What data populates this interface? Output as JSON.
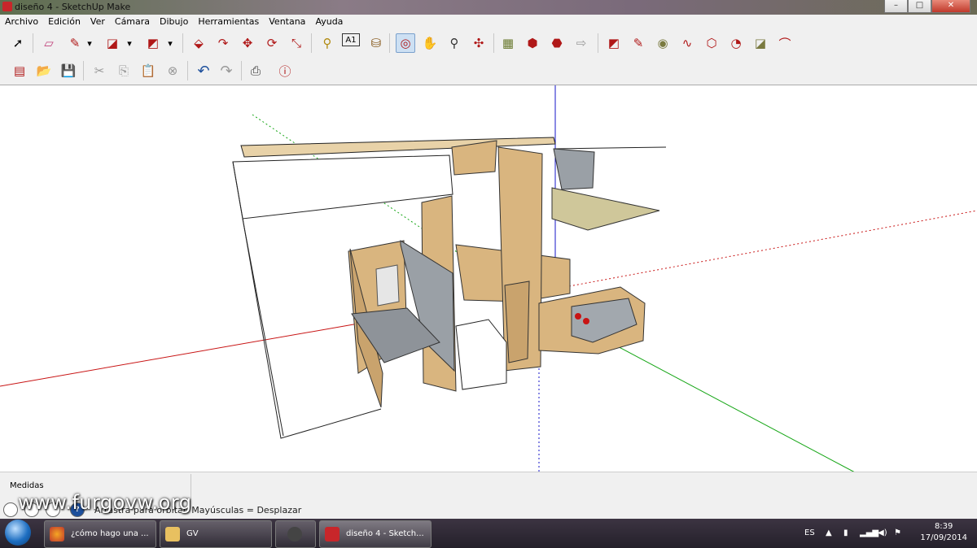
{
  "window": {
    "title": "diseño 4 - SketchUp Make",
    "min": "–",
    "max": "□",
    "close": "✕"
  },
  "menu": [
    "Archivo",
    "Edición",
    "Ver",
    "Cámara",
    "Dibujo",
    "Herramientas",
    "Ventana",
    "Ayuda"
  ],
  "toolbar1": [
    {
      "name": "select-tool-icon",
      "glyph": "➚"
    },
    {
      "name": "eraser-tool-icon",
      "glyph": "▱"
    },
    {
      "name": "pencil-tool-icon",
      "glyph": "✎"
    },
    {
      "name": "dropdown-arrow-icon",
      "glyph": "▾"
    },
    {
      "name": "arc-tool-icon",
      "glyph": "◪"
    },
    {
      "name": "dropdown-arrow-icon",
      "glyph": "▾"
    },
    {
      "name": "rectangle-tool-icon",
      "glyph": "◩"
    },
    {
      "name": "dropdown-arrow-icon",
      "glyph": "▾"
    },
    {
      "name": "push-pull-tool-icon",
      "glyph": "⬙"
    },
    {
      "name": "follow-me-tool-icon",
      "glyph": "↷"
    },
    {
      "name": "move-tool-icon",
      "glyph": "✥"
    },
    {
      "name": "rotate-tool-icon",
      "glyph": "⟳"
    },
    {
      "name": "scale-tool-icon",
      "glyph": "⤡"
    },
    {
      "name": "tape-measure-icon",
      "glyph": "⚲"
    },
    {
      "name": "text-tool-icon",
      "glyph": "A1"
    },
    {
      "name": "paint-bucket-icon",
      "glyph": "⛁"
    },
    {
      "name": "orbit-tool-icon",
      "glyph": "◎"
    },
    {
      "name": "pan-tool-icon",
      "glyph": "✋"
    },
    {
      "name": "zoom-tool-icon",
      "glyph": "⚲"
    },
    {
      "name": "zoom-extents-icon",
      "glyph": "✣"
    },
    {
      "name": "warehouse-icon",
      "glyph": "▦"
    },
    {
      "name": "share-model-icon",
      "glyph": "⬢"
    },
    {
      "name": "extension-warehouse-icon",
      "glyph": "⬣"
    },
    {
      "name": "send-to-layout-icon",
      "glyph": "⇨"
    },
    {
      "name": "sandbox-tool-icon",
      "glyph": "◩"
    },
    {
      "name": "freehand-tool-icon",
      "glyph": "✎"
    },
    {
      "name": "circle-tool-icon",
      "glyph": "◉"
    },
    {
      "name": "curve-tool-icon",
      "glyph": "∿"
    },
    {
      "name": "polygon-tool-icon",
      "glyph": "⬡"
    },
    {
      "name": "pie-tool-icon",
      "glyph": "◔"
    },
    {
      "name": "arc-3pt-tool-icon",
      "glyph": "◪"
    },
    {
      "name": "arc-2pt-tool-icon",
      "glyph": "⌒"
    }
  ],
  "toolbar2": [
    {
      "name": "new-file-icon",
      "glyph": "▤"
    },
    {
      "name": "open-file-icon",
      "glyph": "📂"
    },
    {
      "name": "save-file-icon",
      "glyph": "💾"
    },
    {
      "name": "cut-icon",
      "glyph": "✂"
    },
    {
      "name": "copy-icon",
      "glyph": "⎘"
    },
    {
      "name": "paste-icon",
      "glyph": "📋"
    },
    {
      "name": "delete-icon",
      "glyph": "⊗"
    },
    {
      "name": "undo-icon",
      "glyph": "↶"
    },
    {
      "name": "redo-icon",
      "glyph": "↷"
    },
    {
      "name": "print-icon",
      "glyph": "⎙"
    },
    {
      "name": "model-info-icon",
      "glyph": "ⓘ"
    }
  ],
  "measure": {
    "label": "Medidas"
  },
  "status": {
    "text": "Arrastra para orbitar. Mayúsculas = Desplazar",
    "help": "?"
  },
  "watermark": "www.furgovw.org",
  "taskbar": {
    "items": [
      {
        "label": "¿cómo hago una ..."
      },
      {
        "label": "GV"
      },
      {
        "label": ""
      },
      {
        "label": "diseño 4 - Sketch..."
      }
    ],
    "lang": "ES",
    "time": "8:39",
    "date": "17/09/2014"
  },
  "colors": {
    "accent": "#c8262a",
    "axis_red": "#c81414",
    "axis_green": "#14a514",
    "axis_blue": "#1414c8",
    "wood": "#d9b57f",
    "grey_part": "#8e9399"
  }
}
